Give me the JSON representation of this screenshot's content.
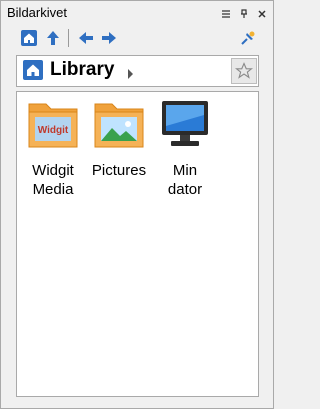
{
  "window": {
    "title": "Bildarkivet"
  },
  "toolbar": {
    "buttons": [
      "home-icon",
      "up-icon",
      "back-icon",
      "forward-icon",
      "pin-icon"
    ]
  },
  "path": {
    "label": "Library"
  },
  "items": [
    {
      "label_line1": "Widgit",
      "label_line2": "Media",
      "thumb_text": "Widgit",
      "icon": "folder-widgit-icon"
    },
    {
      "label_line1": "Pictures",
      "label_line2": "",
      "icon": "folder-pictures-icon"
    },
    {
      "label_line1": "Min",
      "label_line2": "dator",
      "icon": "computer-icon"
    }
  ]
}
